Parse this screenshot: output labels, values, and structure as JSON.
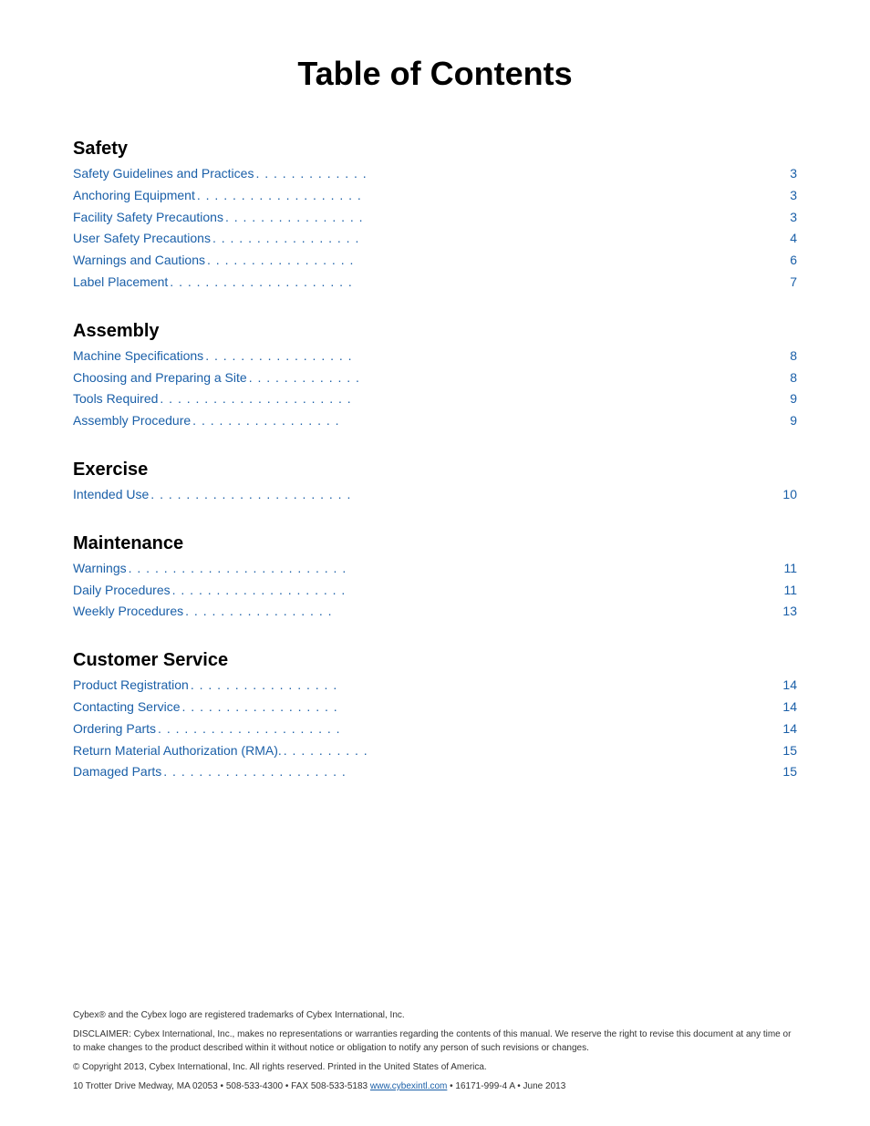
{
  "page": {
    "title": "Table of Contents"
  },
  "sections": [
    {
      "id": "safety",
      "heading": "Safety",
      "entries": [
        {
          "text": "Safety Guidelines and Practices",
          "dots": " . . . . . . . . . . . . .",
          "page": "3"
        },
        {
          "text": "Anchoring Equipment",
          "dots": " . . . . . . . . . . . . . . . . . . .",
          "page": "3"
        },
        {
          "text": "Facility Safety Precautions",
          "dots": " . . . . . . . . . . . . . . . .",
          "page": "3"
        },
        {
          "text": "User Safety Precautions",
          "dots": " . . . . . . . . . . . . . . . . .",
          "page": "4"
        },
        {
          "text": "Warnings and Cautions",
          "dots": " . . . . . . . . . . . . . . . . .",
          "page": "6"
        },
        {
          "text": "Label Placement",
          "dots": " . . . . . . . . . . . . . . . . . . . . .",
          "page": "7"
        }
      ]
    },
    {
      "id": "assembly",
      "heading": "Assembly",
      "entries": [
        {
          "text": "Machine Specifications",
          "dots": " . . . . . . . . . . . . . . . . .",
          "page": "8"
        },
        {
          "text": "Choosing and Preparing a Site",
          "dots": " . . . . . . . . . . . . .",
          "page": "8"
        },
        {
          "text": "Tools Required",
          "dots": "  . . . . . . . . . . . . . . . . . . . . . .",
          "page": "9"
        },
        {
          "text": "Assembly Procedure",
          "dots": " . . . . . . . . . . . . . . . . .",
          "page": "9"
        }
      ]
    },
    {
      "id": "exercise",
      "heading": "Exercise",
      "entries": [
        {
          "text": "Intended Use",
          "dots": " . . . . . . . . . . . . . . . . . . . . . . .",
          "page": "10"
        }
      ]
    },
    {
      "id": "maintenance",
      "heading": "Maintenance",
      "entries": [
        {
          "text": "Warnings",
          "dots": " . . . . . . . . . . . . . . . . . . . . . . . . .",
          "page": "11"
        },
        {
          "text": "Daily Procedures",
          "dots": " . . . . . . . . . . . . . . . . . . . .",
          "page": "11"
        },
        {
          "text": "Weekly Procedures",
          "dots": " . . . . . . . . . . . . . . . . .",
          "page": "13"
        }
      ]
    },
    {
      "id": "customer-service",
      "heading": "Customer Service",
      "entries": [
        {
          "text": "Product Registration",
          "dots": " . . . . . . . . . . . . . . . . .",
          "page": "14"
        },
        {
          "text": "Contacting Service",
          "dots": "  . . . . . . . . . . . . . . . . . .",
          "page": "14"
        },
        {
          "text": "Ordering Parts",
          "dots": " . . . . . . . . . . . . . . . . . . . . .",
          "page": "14"
        },
        {
          "text": "Return Material Authorization (RMA).",
          "dots": " . . . . . . . . . .",
          "page": "15"
        },
        {
          "text": "Damaged Parts",
          "dots": " . . . . . . . . . . . . . . . . . . . . .",
          "page": "15"
        }
      ]
    }
  ],
  "footer": {
    "trademark": "Cybex® and the Cybex logo are registered trademarks of Cybex International, Inc.",
    "disclaimer": "DISCLAIMER: Cybex International, Inc., makes no representations or warranties regarding the contents of this manual. We reserve the right to revise this document at any time or to make changes to the product described within it without notice or obligation to notify any person of such revisions or changes.",
    "copyright": "© Copyright 2013, Cybex International, Inc. All rights reserved. Printed in the United States of America.",
    "address_prefix": "10 Trotter Drive Medway, MA 02053 • 508-533-4300 • FAX 508-533-5183 ",
    "website": "www.cybexintl.com",
    "address_suffix": " • 16171-999-4 A • June 2013"
  }
}
